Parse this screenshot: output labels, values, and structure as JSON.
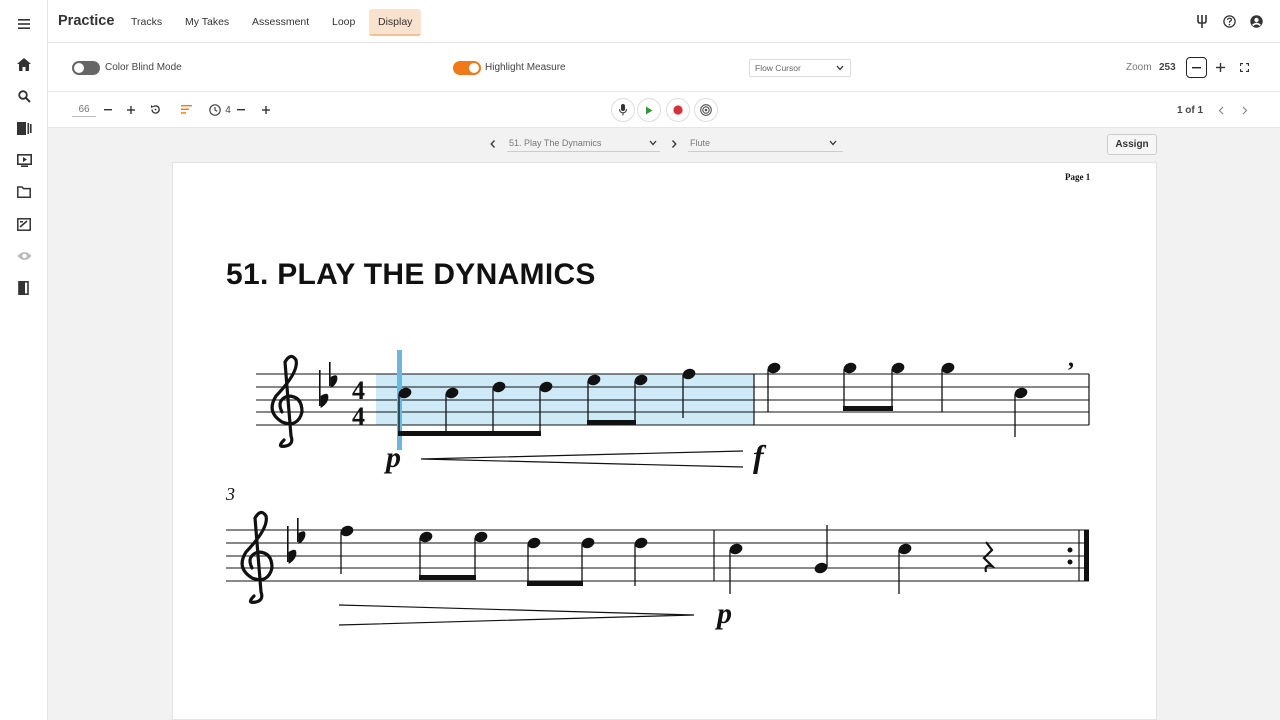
{
  "app": {
    "brand": "Practice",
    "tabs": [
      "Tracks",
      "My Takes",
      "Assessment",
      "Loop",
      "Display"
    ],
    "active_tab": "Display"
  },
  "sidebar": {
    "icons": [
      "menu-icon",
      "home-icon",
      "search-icon",
      "library-icon",
      "video-icon",
      "folder-icon",
      "assignments-icon",
      "visibility-icon",
      "exit-icon"
    ]
  },
  "settings": {
    "color_blind_label": "Color Blind Mode",
    "color_blind_on": false,
    "highlight_label": "Highlight Measure",
    "highlight_on": true,
    "cursor_select": "Flow Cursor",
    "zoom_label": "Zoom",
    "zoom_value": "253"
  },
  "controls": {
    "tempo": "66",
    "count_in": "4",
    "pages": "1 of 1"
  },
  "score_toolbar": {
    "piece": "51. Play The Dynamics",
    "instrument": "Flute",
    "assign_label": "Assign"
  },
  "score": {
    "page_label": "Page 1",
    "title": "51.  PLAY THE DYNAMICS",
    "measure_number": "3",
    "dynamics": [
      "p",
      "f",
      "p"
    ]
  },
  "colors": {
    "accent": "#f07a1a",
    "active_tab_bg": "#f9e3cf",
    "highlight": "#cdeaf6",
    "cursor": "#6bb8dc",
    "play": "#2e9d2e",
    "record": "#d6303a"
  }
}
